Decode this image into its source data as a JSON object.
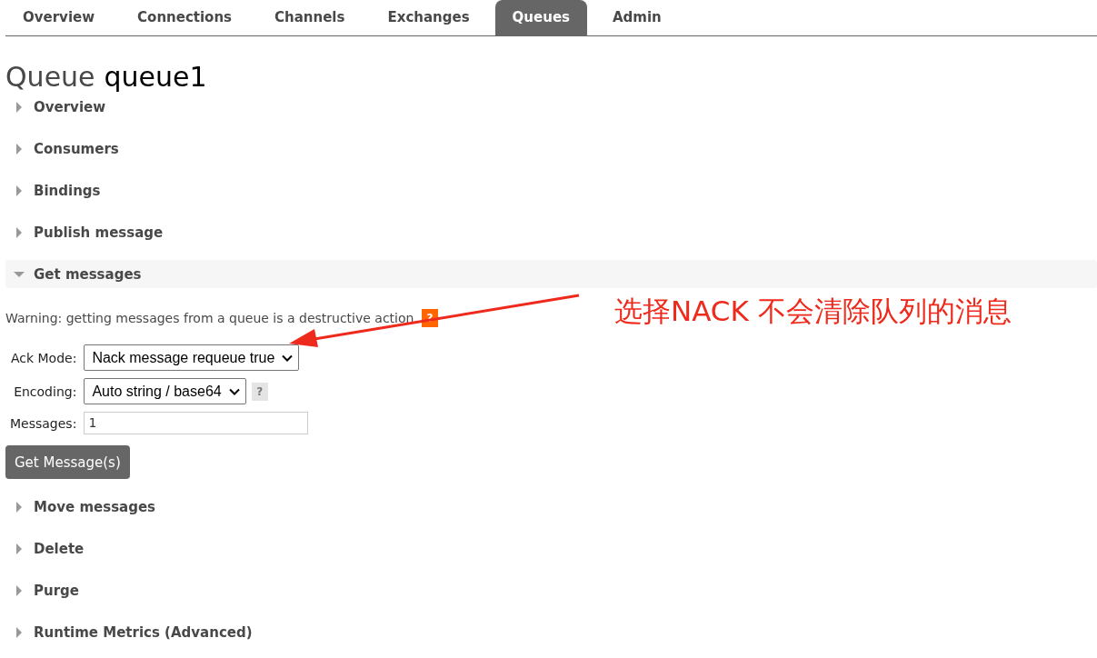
{
  "tabs": [
    {
      "label": "Overview",
      "selected": false
    },
    {
      "label": "Connections",
      "selected": false
    },
    {
      "label": "Channels",
      "selected": false
    },
    {
      "label": "Exchanges",
      "selected": false
    },
    {
      "label": "Queues",
      "selected": true
    },
    {
      "label": "Admin",
      "selected": false
    }
  ],
  "heading": {
    "prefix": "Queue",
    "name": "queue1"
  },
  "sections": [
    {
      "label": "Overview",
      "expanded": false
    },
    {
      "label": "Consumers",
      "expanded": false
    },
    {
      "label": "Bindings",
      "expanded": false
    },
    {
      "label": "Publish message",
      "expanded": false
    },
    {
      "label": "Get messages",
      "expanded": true,
      "form": {
        "warning": "Warning: getting messages from a queue is a destructive action.",
        "warning_help": "?",
        "fields": [
          {
            "kind": "select",
            "label": "Ack Mode:",
            "value": "Nack message requeue true"
          },
          {
            "kind": "select",
            "label": "Encoding:",
            "value": "Auto string / base64",
            "help": "?"
          },
          {
            "kind": "input",
            "label": "Messages:",
            "value": "1"
          }
        ],
        "button": "Get Message(s)"
      }
    },
    {
      "label": "Move messages",
      "expanded": false
    },
    {
      "label": "Delete",
      "expanded": false
    },
    {
      "label": "Purge",
      "expanded": false
    },
    {
      "label": "Runtime Metrics (Advanced)",
      "expanded": false
    }
  ],
  "annotation": {
    "text": "选择NACK 不会清除队列的消息"
  }
}
